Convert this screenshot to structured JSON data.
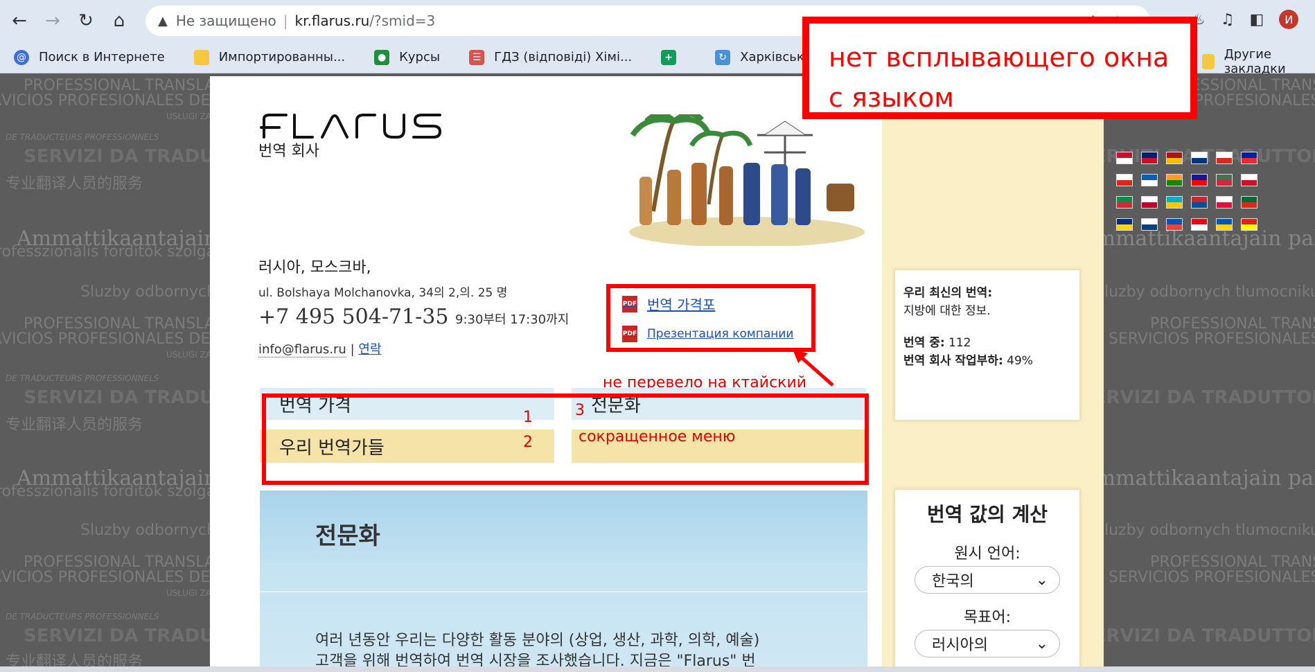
{
  "browser": {
    "security_label": "Не защищено",
    "url_host": "kr.flarus.ru",
    "url_path": "/?smid=3",
    "profile_initial": "И",
    "bookmarks": [
      "Поиск в Интернете",
      "Импортированны...",
      "Курсы",
      "ГДЗ (відповіді) Хімі...",
      "",
      "Харківська спеціал..."
    ],
    "other_bookmarks": "Другие закладки"
  },
  "watermark": {
    "line1": "PROFESSIONAL TRANSLATION SERVICES",
    "line2": "SERVICIOS PROFESIONALES DE LOS TRADUCTORES",
    "line3": "USŁUGI ZAWODOWYCH TŁUMACZY",
    "line4": "DE TRADUCTEURS PROFESSIONNELS",
    "line5": "SERVIZI DA TRADUTTORI PROFESSIONISTI",
    "line6": "专业翻译人员的服务",
    "line7": "Ammattikaantajain palvelut",
    "line8": "professzionális fordítók szolgáltatásai",
    "line9": "Sluzby odbornych tlumocniku"
  },
  "site": {
    "logo_text": "FLARUS",
    "logo_sub": "번역 회사",
    "address_city": "러시아, 모스크바,",
    "address_street": "ul. Bolshaya Molchanovka, 34의 2,의. 25 명",
    "phone": "+7 495 504-71-35",
    "hours": "9:30부터 17:30까지",
    "email": "info@flarus.ru",
    "separator": "|",
    "contact_link": "연락",
    "pdf_links": [
      "번역 가격포",
      "Презентация компании"
    ],
    "pdf_icon_text": "PDF",
    "menu": [
      {
        "label": "번역 가격",
        "number": "1"
      },
      {
        "label": "우리 번역가들",
        "number": "2"
      },
      {
        "label": "전문화",
        "number": "3"
      }
    ],
    "spec_title": "전문화",
    "spec_text_line1": "여러 년동안 우리는 다양한 활동 분야의 (상업, 생산, 과학, 의학, 예술)",
    "spec_text_line2": "고객을 위해 번역하여 번역 시장을 조사했습니다. 지금은 \"Flarus\" 번"
  },
  "sidebar": {
    "stats": {
      "latest_label": "우리 최신의 번역:",
      "latest_value": "지방에 대한 정보.",
      "in_progress_label": "번역 중:",
      "in_progress_value": "112",
      "load_label": "번역 회사 작업부하:",
      "load_value": "49%"
    },
    "calc": {
      "title": "번역 값의 계산",
      "source_label": "원시 언어:",
      "source_value": "한국의",
      "target_label": "목표어:",
      "target_value": "러시아의"
    }
  },
  "annotations": {
    "popup_note": "нет всплывающего окна с языком",
    "not_translated_note": "не перевело на ктайский",
    "short_menu_note": "сокращенное меню"
  },
  "colors": {
    "annotation_red": "#ff0000",
    "link_blue": "#1a4fb5",
    "sidebar_bg": "#fbefc8",
    "menu_blue": "#dcedf5",
    "menu_yellow": "#f5e3a7"
  }
}
